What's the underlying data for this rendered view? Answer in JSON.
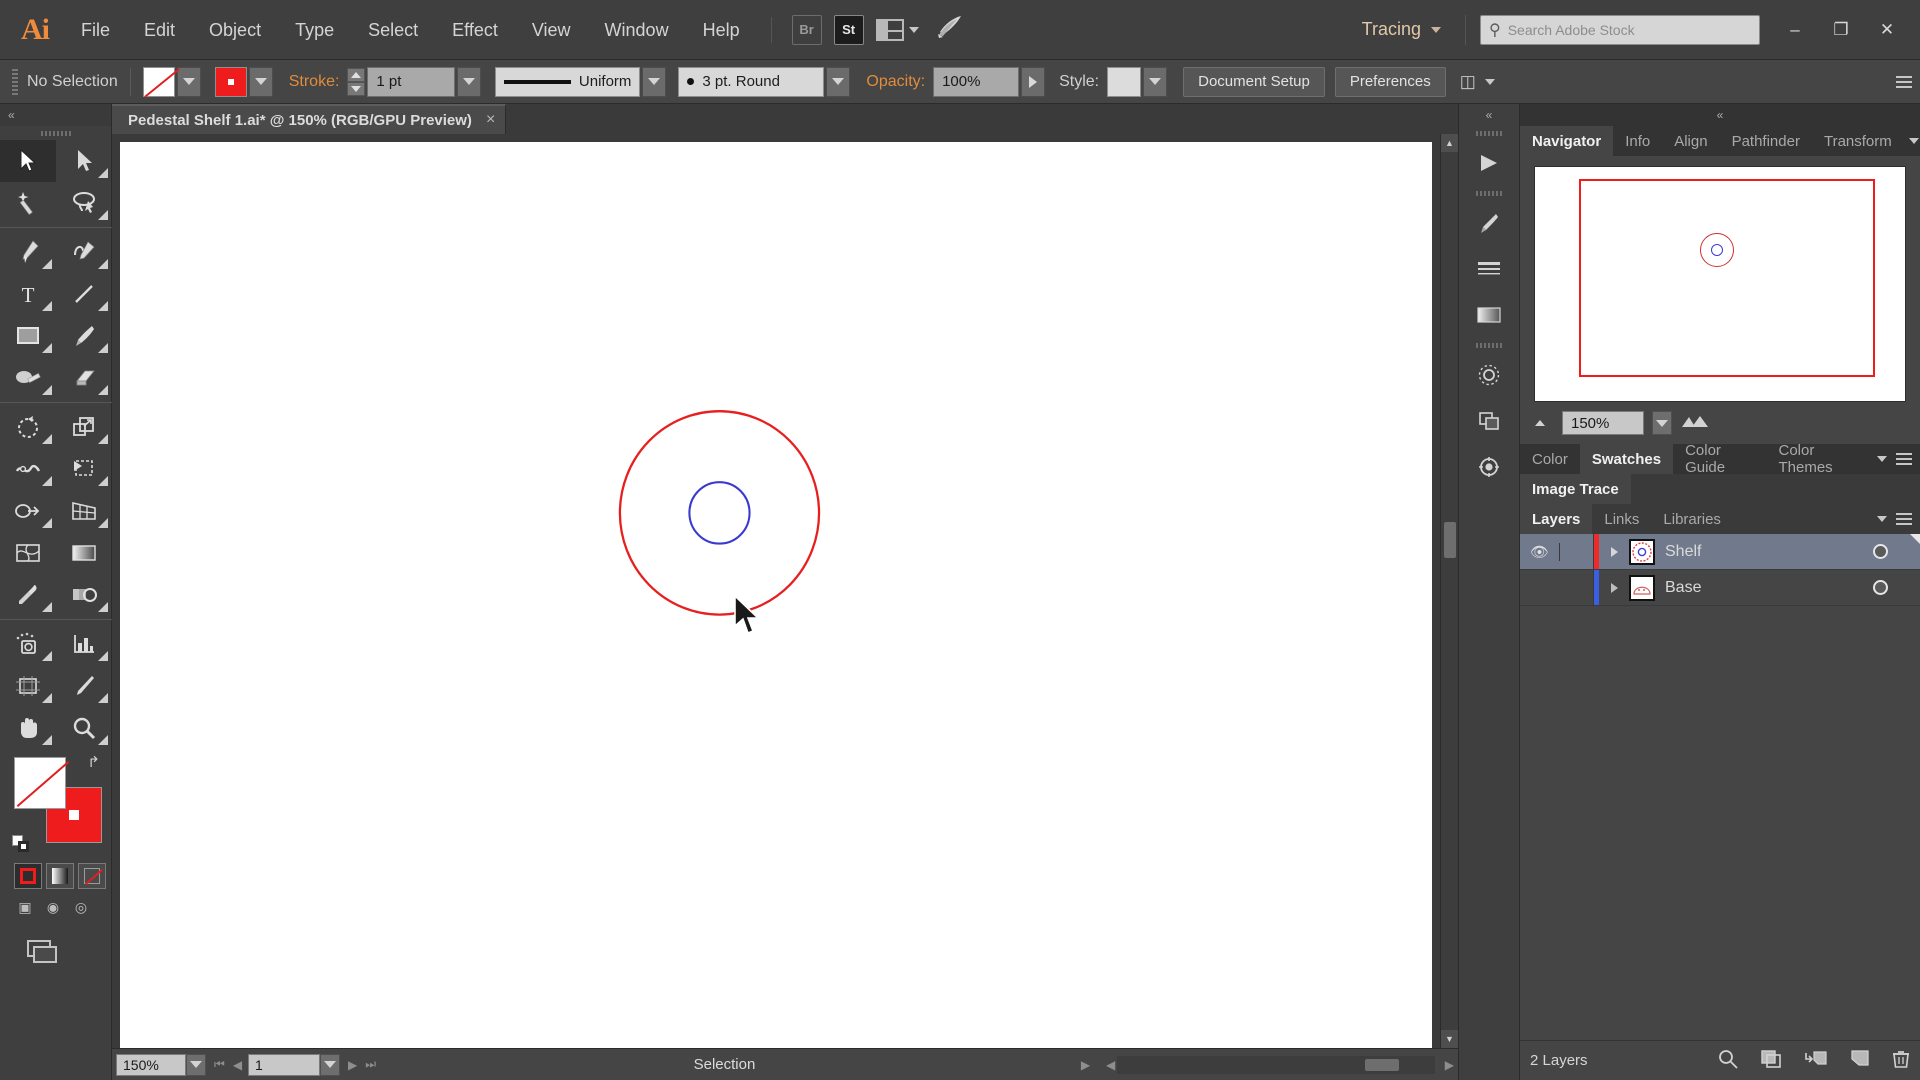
{
  "app": {
    "logo": "Ai",
    "menus": [
      "File",
      "Edit",
      "Object",
      "Type",
      "Select",
      "Effect",
      "View",
      "Window",
      "Help"
    ],
    "quick_buttons": [
      {
        "name": "bridge",
        "label": "Br"
      },
      {
        "name": "stock",
        "label": "St"
      }
    ],
    "arrange_documents_label": "Arrange Documents",
    "workspace": {
      "label": "Tracing"
    },
    "search": {
      "placeholder": "Search Adobe Stock",
      "value": ""
    },
    "window_controls": {
      "minimize": "–",
      "maximize": "❐",
      "close": "✕"
    }
  },
  "control_bar": {
    "selection_status": "No Selection",
    "fill_label": "Fill",
    "stroke_swatch_label": "Stroke color",
    "stroke_label": "Stroke:",
    "stroke_weight": "1 pt",
    "stroke_profile": "Uniform",
    "brush_definition": "3 pt. Round",
    "opacity_label": "Opacity:",
    "opacity_value": "100%",
    "style_label": "Style:",
    "document_setup": "Document Setup",
    "preferences": "Preferences"
  },
  "document": {
    "tab_title": "Pedestal Shelf 1.ai* @ 150% (RGB/GPU Preview)",
    "close_label": "×"
  },
  "tools": [
    {
      "name": "selection-tool",
      "active": true
    },
    {
      "name": "direct-selection-tool",
      "active": false
    },
    {
      "name": "magic-wand-tool",
      "active": false
    },
    {
      "name": "lasso-tool",
      "active": false
    },
    {
      "name": "pen-tool",
      "active": false
    },
    {
      "name": "curvature-tool",
      "active": false
    },
    {
      "name": "type-tool",
      "active": false
    },
    {
      "name": "line-segment-tool",
      "active": false
    },
    {
      "name": "rectangle-tool",
      "active": false
    },
    {
      "name": "paintbrush-tool",
      "active": false
    },
    {
      "name": "shaper-tool",
      "active": false
    },
    {
      "name": "eraser-tool",
      "active": false
    },
    {
      "name": "rotate-tool",
      "active": false
    },
    {
      "name": "scale-tool",
      "active": false
    },
    {
      "name": "width-tool",
      "active": false
    },
    {
      "name": "free-transform-tool",
      "active": false
    },
    {
      "name": "shape-builder-tool",
      "active": false
    },
    {
      "name": "perspective-grid-tool",
      "active": false
    },
    {
      "name": "mesh-tool",
      "active": false
    },
    {
      "name": "gradient-tool",
      "active": false
    },
    {
      "name": "eyedropper-tool",
      "active": false
    },
    {
      "name": "blend-tool",
      "active": false
    },
    {
      "name": "symbol-sprayer-tool",
      "active": false
    },
    {
      "name": "column-graph-tool",
      "active": false
    },
    {
      "name": "artboard-tool",
      "active": false
    },
    {
      "name": "slice-tool",
      "active": false
    },
    {
      "name": "hand-tool",
      "active": false
    },
    {
      "name": "zoom-tool",
      "active": false
    }
  ],
  "color_controls": {
    "fill": "none",
    "stroke": "#ee1c1c",
    "fill_modes": [
      "color",
      "gradient",
      "none"
    ],
    "selected_fill_mode": "color"
  },
  "status_bar": {
    "zoom": "150%",
    "page": "1",
    "status_text": "Selection"
  },
  "navigator": {
    "tabs": [
      {
        "label": "Navigator",
        "active": true
      },
      {
        "label": "Info",
        "active": false
      },
      {
        "label": "Align",
        "active": false
      },
      {
        "label": "Pathfinder",
        "active": false
      },
      {
        "label": "Transform",
        "active": false
      }
    ],
    "zoom": "150%"
  },
  "color_panel": {
    "tabs": [
      {
        "label": "Color",
        "active": false
      },
      {
        "label": "Swatches",
        "active": true
      },
      {
        "label": "Color Guide",
        "active": false
      },
      {
        "label": "Color Themes",
        "active": false
      }
    ]
  },
  "image_trace": {
    "tabs": [
      {
        "label": "Image Trace",
        "active": true
      }
    ]
  },
  "layers_panel": {
    "tabs": [
      {
        "label": "Layers",
        "active": true
      },
      {
        "label": "Links",
        "active": false
      },
      {
        "label": "Libraries",
        "active": false
      }
    ],
    "rows": [
      {
        "name": "Shelf",
        "color": "#ee2a2a",
        "visible": true,
        "selected": true,
        "locked": false
      },
      {
        "name": "Base",
        "color": "#3a5fe0",
        "visible": false,
        "selected": false,
        "locked": false
      }
    ],
    "footer_count": "2 Layers",
    "footer_icons": [
      "locate-object",
      "make-clipping-mask",
      "create-new-sublayer",
      "create-new-layer",
      "delete-selection"
    ]
  },
  "artwork": {
    "outer_circle_color": "#e81f1f",
    "inner_circle_color": "#3a3ad0"
  }
}
